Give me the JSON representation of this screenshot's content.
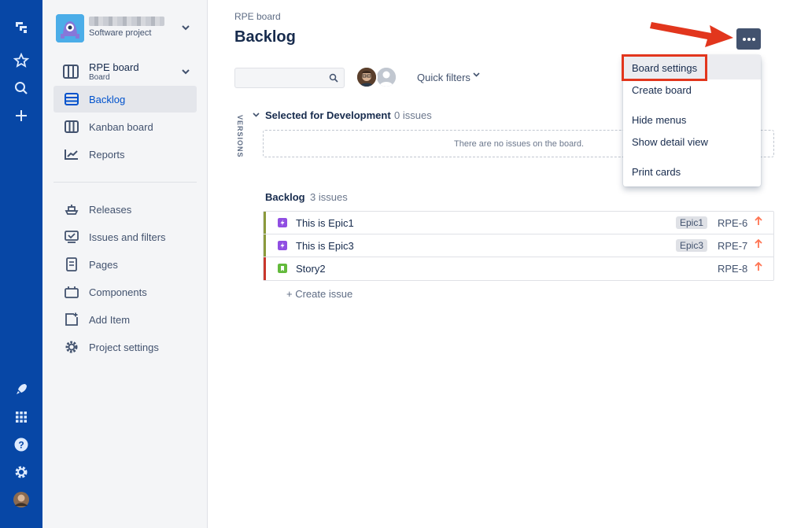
{
  "project": {
    "subtitle": "Software project"
  },
  "board_switcher": {
    "name": "RPE board",
    "type": "Board"
  },
  "sidebar": {
    "items": [
      {
        "label": "Backlog",
        "icon": "backlog-icon",
        "active": true
      },
      {
        "label": "Kanban board",
        "icon": "kanban-board-icon"
      },
      {
        "label": "Reports",
        "icon": "reports-icon"
      },
      {
        "label": "Releases",
        "icon": "releases-icon"
      },
      {
        "label": "Issues and filters",
        "icon": "issues-filters-icon"
      },
      {
        "label": "Pages",
        "icon": "pages-icon"
      },
      {
        "label": "Components",
        "icon": "components-icon"
      },
      {
        "label": "Add Item",
        "icon": "add-item-icon"
      },
      {
        "label": "Project settings",
        "icon": "gear-icon"
      }
    ]
  },
  "header": {
    "breadcrumb": "RPE board",
    "title": "Backlog"
  },
  "toolbar": {
    "quick_filters": "Quick filters"
  },
  "versions_label": "VERSIONS",
  "sprint": {
    "title": "Selected for Development",
    "count": "0 issues",
    "empty": "There are no issues on the board."
  },
  "backlog": {
    "title": "Backlog",
    "count": "3 issues",
    "issues": [
      {
        "summary": "This is Epic1",
        "epic": "Epic1",
        "key": "RPE-6",
        "type": "epic",
        "priority": "high"
      },
      {
        "summary": "This is Epic3",
        "epic": "Epic3",
        "key": "RPE-7",
        "type": "epic",
        "priority": "high"
      },
      {
        "summary": "Story2",
        "epic": "",
        "key": "RPE-8",
        "type": "story",
        "priority": "high"
      }
    ],
    "create_label": "+   Create issue"
  },
  "menu": {
    "items": [
      "Board settings",
      "Create board",
      "Hide menus",
      "Show detail view",
      "Print cards"
    ]
  },
  "colors": {
    "nav": "#0747a6",
    "accent": "#0052cc",
    "epic_type": "#904ee2",
    "story_type": "#63ba3c",
    "priority": "#ff7452",
    "highlight": "#e2361d"
  }
}
